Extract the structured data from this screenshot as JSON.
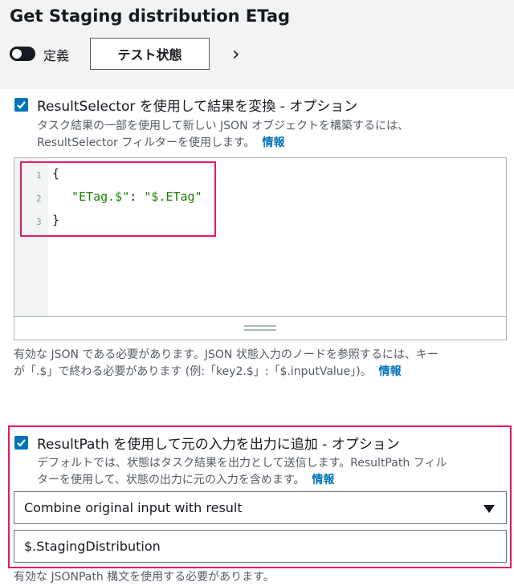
{
  "header": {
    "title": "Get Staging distribution ETag",
    "toggle_label": "定義",
    "test_button": "テスト状態"
  },
  "result_selector": {
    "label": "ResultSelector を使用して結果を変換 - オプション",
    "checked": true,
    "desc_line1": "タスク結果の一部を使用して新しい JSON オブジェクトを構築するには、",
    "desc_line2": "ResultSelector フィルターを使用します。",
    "info_link": "情報",
    "code_lines": [
      {
        "num": "1",
        "text": "{"
      },
      {
        "num": "2",
        "key": "\"ETag.$\"",
        "sep": ": ",
        "value": "\"$.ETag\""
      },
      {
        "num": "3",
        "text": "}"
      }
    ],
    "help_line1": "有効な JSON である必要があります。JSON 状態入力のノードを参照するには、キー",
    "help_line2": "が「.$」で終わる必要があります (例:「key2.$」:「$.inputValue」)。",
    "help_info": "情報"
  },
  "result_path": {
    "label": "ResultPath を使用して元の入力を出力に追加 - オプション",
    "checked": true,
    "desc_line1": "デフォルトでは、状態はタスク結果を出力として送信します。ResultPath フィル",
    "desc_line2": "ターを使用して、状態の出力に元の入力を含めます。",
    "info_link": "情報",
    "select_value": "Combine original input with result",
    "input_value": "$.StagingDistribution",
    "footnote": "有効な JSONPath 構文を使用する必要があります。"
  },
  "colors": {
    "accent": "#0073bb",
    "highlight": "#e6195f",
    "json_string": "#1d8102"
  }
}
